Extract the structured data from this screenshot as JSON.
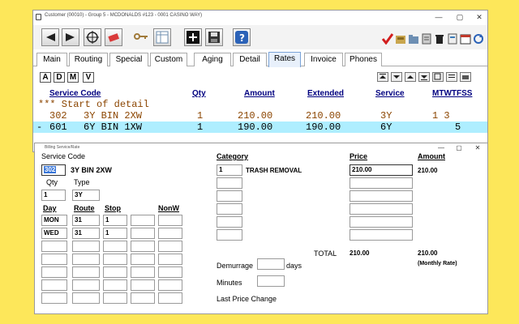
{
  "main_window": {
    "title": "Customer (00010) - Group 5 - MCDONALDS #123 - 0001 CASINO WAY)",
    "controls": {
      "minimize": "—",
      "maximize": "▢",
      "close": "✕"
    }
  },
  "tabs": [
    "Main",
    "Routing",
    "Special",
    "Custom",
    "Aging",
    "Detail",
    "Rates",
    "Invoice",
    "Phones"
  ],
  "active_tab": "Rates",
  "edit_buttons": [
    "A",
    "D",
    "M",
    "V"
  ],
  "grid": {
    "headers": {
      "service_code": "Service Code",
      "qty": "Qty",
      "amount": "Amount",
      "extended": "Extended",
      "service": "Service",
      "days": "MTWTFSS"
    },
    "note": "*** Start of detail",
    "rows": [
      {
        "marker": "",
        "code": "302",
        "desc": "3Y BIN 2XW",
        "qty": "1",
        "amount": "210.00",
        "extended": "210.00",
        "service": "3Y",
        "days": "1 3"
      },
      {
        "marker": "-",
        "code": "601",
        "desc": "6Y BIN 1XW",
        "qty": "1",
        "amount": "190.00",
        "extended": "190.00",
        "service": "6Y",
        "days": "5"
      }
    ]
  },
  "detail_window": {
    "title": "Billing Service/Rate",
    "controls": {
      "minimize": "—",
      "maximize": "▢",
      "close": "✕"
    },
    "service_code_label": "Service Code",
    "service_code": "302",
    "service_desc": "3Y BIN 2XW",
    "qty_label": "Qty",
    "qty": "1",
    "type_label": "Type",
    "type": "3Y",
    "schedule_headers": {
      "day": "Day",
      "route": "Route",
      "stop": "Stop",
      "nonw": "NonW"
    },
    "schedule": [
      {
        "day": "MON",
        "route": "31",
        "stop": "1"
      },
      {
        "day": "WED",
        "route": "31",
        "stop": "1"
      }
    ],
    "charge_headers": {
      "category": "Category",
      "price": "Price",
      "amount": "Amount"
    },
    "charges": [
      {
        "code": "1",
        "category": "TRASH REMOVAL",
        "price": "210.00",
        "amount": "210.00"
      }
    ],
    "total_label": "TOTAL",
    "total_price": "210.00",
    "total_amount": "210.00",
    "rate_note": "(Monthly Rate)",
    "demurrage_label": "Demurrage",
    "demurrage_unit": "days",
    "minutes_label": "Minutes",
    "last_price_change_label": "Last Price Change"
  },
  "colors": {
    "background": "#fde75a",
    "grid_text": "#8b4500",
    "grid_selected_row": "#aeeeff",
    "header_text": "#000080",
    "active_tab": "#e8f0fb"
  }
}
